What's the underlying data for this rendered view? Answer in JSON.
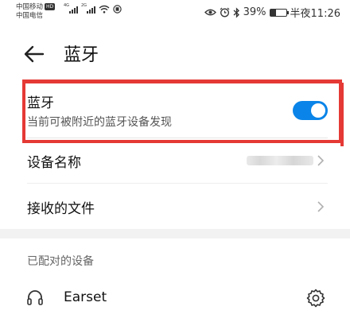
{
  "status_bar": {
    "carrier1": "中国移动",
    "carrier1_badge": "HD",
    "carrier2": "中国电信",
    "signal1_label": "4G",
    "signal2_label": "2G",
    "battery": "39%",
    "battery_level": 0.39,
    "time": "半夜11:26",
    "icons": [
      "eye-icon",
      "alarm-icon",
      "bluetooth-icon",
      "battery-icon",
      "wifi-icon",
      "signal-icon"
    ]
  },
  "header": {
    "back_icon": "back-arrow-icon",
    "title": "蓝牙"
  },
  "bluetooth": {
    "label": "蓝牙",
    "subtitle": "当前可被附近的蓝牙设备发现",
    "enabled": true,
    "toggle_color": "#0a84e8"
  },
  "rows": {
    "device_name_label": "设备名称",
    "received_files_label": "接收的文件"
  },
  "paired": {
    "section_title": "已配对的设备",
    "devices": [
      {
        "name": "Earset",
        "icon": "headset-icon",
        "action_icon": "settings-icon"
      }
    ]
  },
  "annotation_color": "#e53935"
}
